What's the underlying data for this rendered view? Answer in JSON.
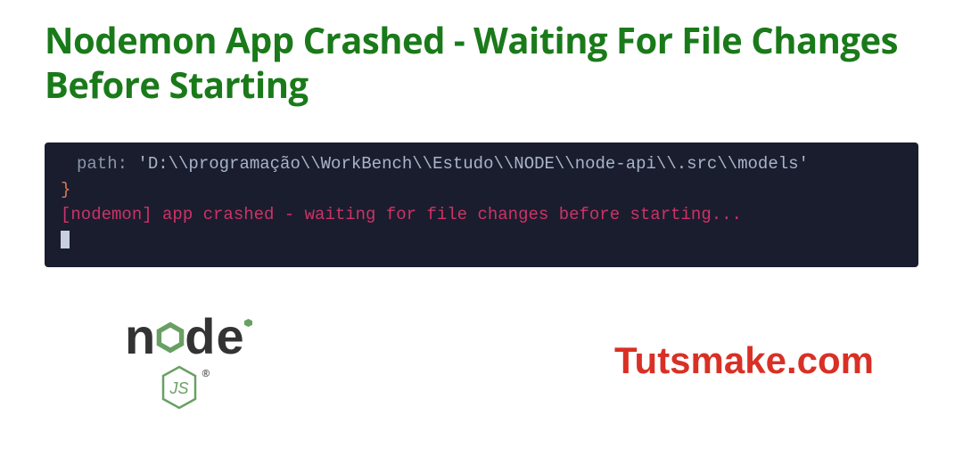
{
  "title": "Nodemon App Crashed - Waiting For File Changes Before Starting",
  "terminal": {
    "path_key": "path:",
    "path_value": "'D:\\\\programação\\\\WorkBench\\\\Estudo\\\\NODE\\\\node-api\\\\.src\\\\models'",
    "closing_brace": "}",
    "error_message": "[nodemon] app crashed - waiting for file changes before starting..."
  },
  "logo": {
    "text_n1": "n",
    "text_o2": "o",
    "text_d": "d",
    "text_e": "e",
    "js_label": "JS",
    "tm": "®"
  },
  "brand": "Tutsmake.com",
  "colors": {
    "title_green": "#1a7a1a",
    "terminal_bg": "#1a1d2e",
    "error_pink": "#cc3366",
    "node_green": "#68a063",
    "brand_red": "#d93025"
  }
}
